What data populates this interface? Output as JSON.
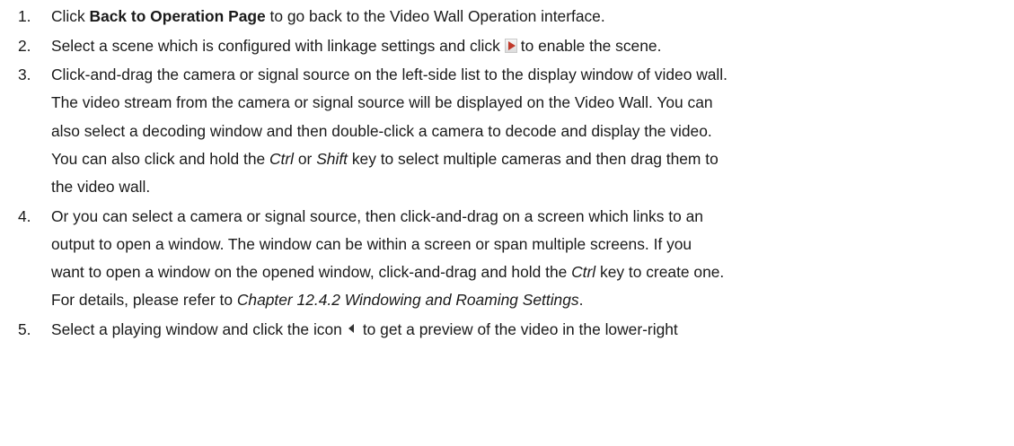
{
  "steps": [
    {
      "num": "1.",
      "lines": [
        {
          "a": "Click ",
          "b": "Back to Operation Page",
          "c": " to go back to the Video Wall Operation interface."
        }
      ]
    },
    {
      "num": "2.",
      "lines": [
        {
          "a": "Select a scene which is configured with linkage settings and click",
          "c": "to enable the scene."
        }
      ]
    },
    {
      "num": "3.",
      "lines": [
        "Click-and-drag the camera or signal source on the left-side list to the display window of video wall.",
        "The video stream from the camera or signal source will be displayed on the Video Wall. You can",
        "also select a decoding window and then double-click a camera to decode and display the video.",
        {
          "a": "You can also click and hold the ",
          "i1": "Ctrl",
          "b": " or ",
          "i2": "Shift",
          "c": " key to select multiple cameras and then drag them to"
        },
        "the video wall."
      ]
    },
    {
      "num": "4.",
      "lines": [
        "Or you can select a camera or signal source, then click-and-drag on a screen which links to an",
        "output to open a window. The window can be within a screen or span multiple screens. If you",
        {
          "a": "want to open a window on the opened window, click-and-drag and hold the ",
          "i1": "Ctrl",
          "c": " key to create one."
        },
        {
          "a": "For details, please refer to ",
          "i1": "Chapter 12.4.2 Windowing and Roaming Settings",
          "c": "."
        }
      ]
    },
    {
      "num": "5.",
      "lines": [
        {
          "a": "Select a playing window and click the icon",
          "c": "to get a preview of the video in the lower-right"
        }
      ]
    }
  ],
  "icons": {
    "enable_scene": "play-icon",
    "preview": "left-arrow-icon"
  }
}
